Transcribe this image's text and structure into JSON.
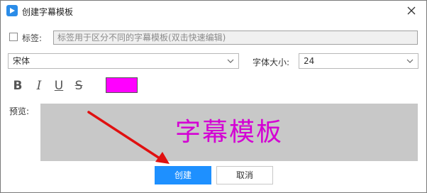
{
  "window": {
    "title": "创建字幕模板"
  },
  "tag": {
    "label": "标签:",
    "placeholder": "标签用于区分不同的字幕模板(双击快速编辑)",
    "checked": false
  },
  "font": {
    "value": "宋体"
  },
  "size": {
    "label": "字体大小:",
    "value": "24"
  },
  "style": {
    "bold": "B",
    "italic": "I",
    "underline": "U",
    "strike": "S",
    "color": "#ff00ff"
  },
  "preview": {
    "label": "预览:",
    "text": "字幕模板",
    "background": "#c8c8c8",
    "text_color": "#d400d4"
  },
  "buttons": {
    "create": "创建",
    "cancel": "取消"
  },
  "colors": {
    "accent": "#1e90ff",
    "arrow": "#e01010"
  }
}
